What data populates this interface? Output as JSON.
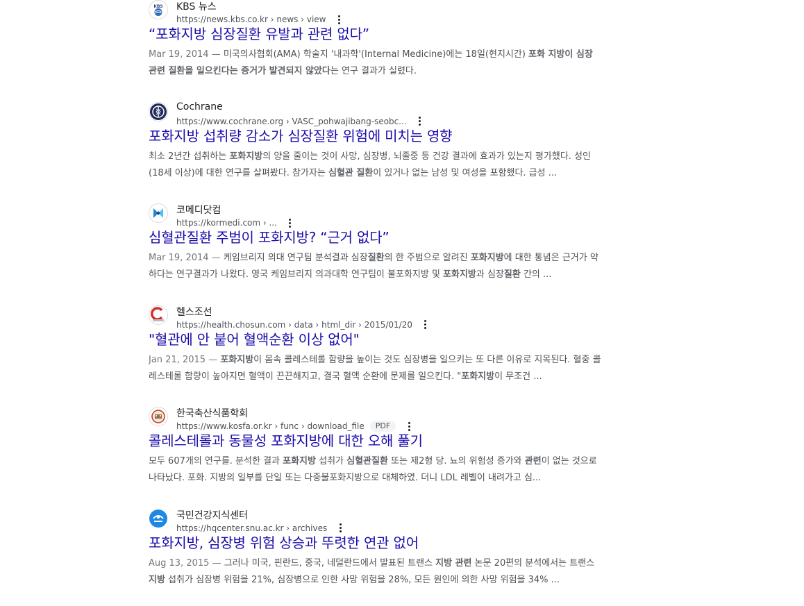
{
  "colors": {
    "link": "#1a0dab",
    "text": "#4d5156",
    "site_name": "#202124"
  },
  "results": [
    {
      "site_name": "KBS 뉴스",
      "url": "https://news.kbs.co.kr › news › view",
      "title": "“포화지방 심장질환 유발과 관련 없다”",
      "favicon": "kbs-logo-icon",
      "snippet": [
        {
          "t": "Mar 19, 2014 — ",
          "date": true
        },
        {
          "t": "미국의사협회(AMA) 학술지 '내과학'(Internal Medicine)에는 18일(현지시간) "
        },
        {
          "t": "포화 지방이 심장 관련 질환을 일으킨다는 증거가 발견되지 않았다",
          "b": true
        },
        {
          "t": "는 연구 결과가 실렸다."
        }
      ]
    },
    {
      "site_name": "Cochrane",
      "url": "https://www.cochrane.org › VASC_pohwajibang-seobc...",
      "title": "포화지방 섭취량 감소가 심장질환 위험에 미치는 영향",
      "favicon": "cochrane-logo-icon",
      "snippet": [
        {
          "t": "최소 2년간 섭취하는 "
        },
        {
          "t": "포화지방",
          "b": true
        },
        {
          "t": "의 양을 줄이는 것이 사망, 심장병, 뇌졸중 등 건강 결과에 효과가 있는지 평가했다. 성인(18세 이상)에 대한 연구를 살펴봤다. 참가자는 "
        },
        {
          "t": "심혈관 질환",
          "b": true
        },
        {
          "t": "이 있거나 없는 남성 및 여성을 포함했다. 급성 ..."
        }
      ]
    },
    {
      "site_name": "코메디닷컴",
      "url": "https://kormedi.com › ...",
      "title": "심혈관질환 주범이 포화지방? “근거 없다”",
      "favicon": "kormedi-logo-icon",
      "snippet": [
        {
          "t": "Mar 19, 2014 — ",
          "date": true
        },
        {
          "t": "케임브리지 의대 연구팀 분석결과 심장"
        },
        {
          "t": "질환",
          "b": true
        },
        {
          "t": "의 한 주범으로 알려진 "
        },
        {
          "t": "포화지방",
          "b": true
        },
        {
          "t": "에 대한 통념은 근거가 약하다는 연구결과가 나왔다. 영국 케임브리지 의과대학 연구팀이 불포화지방 및 "
        },
        {
          "t": "포화지방",
          "b": true
        },
        {
          "t": "과 심장"
        },
        {
          "t": "질환",
          "b": true
        },
        {
          "t": " 간의 ..."
        }
      ]
    },
    {
      "site_name": "헬스조선",
      "url": "https://health.chosun.com › data › html_dir › 2015/01/20",
      "title": "\"혈관에 안 붙어 혈액순환 이상 없어\"",
      "favicon": "health-chosun-logo-icon",
      "snippet": [
        {
          "t": "Jan 21, 2015 — ",
          "date": true
        },
        {
          "t": "포화지방",
          "b": true
        },
        {
          "t": "이 몸속 콜레스테롤 함량을 높이는 것도 심장병을 일으키는 또 다른 이유로 지목된다. 혈중 콜레스테롤 함량이 높아지면 혈액이 끈끈해지고, 결국 혈액 순환에 문제를 일으킨다. \""
        },
        {
          "t": "포화지방",
          "b": true
        },
        {
          "t": "이 무조건 ..."
        }
      ]
    },
    {
      "site_name": "한국축산식품학회",
      "url": "https://www.kosfa.or.kr › func › download_file",
      "badge": "PDF",
      "title": "콜레스테롤과 동물성 포화지방에 대한 오해 풀기",
      "favicon": "kosfa-logo-icon",
      "snippet": [
        {
          "t": "모두 607개의 연구를. 분석한 결과 "
        },
        {
          "t": "포화지방",
          "b": true
        },
        {
          "t": " 섭취가 "
        },
        {
          "t": "심혈관질환",
          "b": true
        },
        {
          "t": " 또는 제2형 당. 뇨의 위험성 증가와 "
        },
        {
          "t": "관련",
          "b": true
        },
        {
          "t": "이 없는 것으로 나타났다. 포화. 지방의 일부를 단일 또는 다중불포화지방으로 대체하였. 더니 LDL 레벨이 내려가고 심..."
        }
      ]
    },
    {
      "site_name": "국민건강지식센터",
      "url": "https://hqcenter.snu.ac.kr › archives",
      "title": "포화지방, 심장병 위험 상승과 뚜렷한 연관 없어",
      "favicon": "hqcenter-logo-icon",
      "snippet": [
        {
          "t": "Aug 13, 2015 — ",
          "date": true
        },
        {
          "t": "그러나 미국, 핀란드, 중국, 네덜란드에서 발표된 트랜스 "
        },
        {
          "t": "지방 관련",
          "b": true
        },
        {
          "t": " 논문 20편의 분석에서는 트랜스 "
        },
        {
          "t": "지방",
          "b": true
        },
        {
          "t": " 섭취가 심장병 위험을 21%, 심장병으로 인한 사망 위험을 28%, 모든 원인에 의한 사망 위험을 34% ..."
        }
      ]
    }
  ]
}
